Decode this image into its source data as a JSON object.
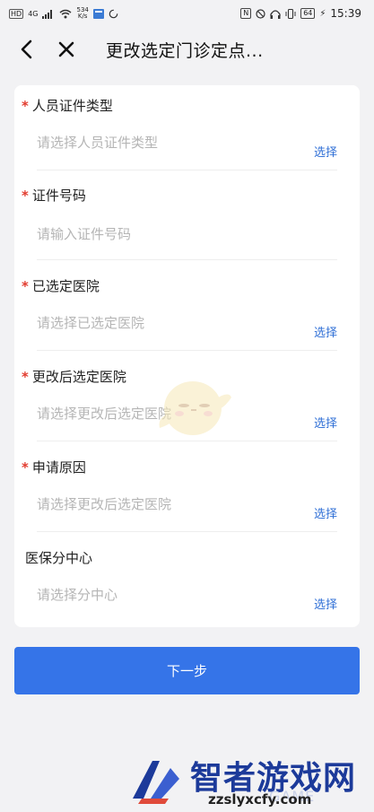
{
  "status_bar": {
    "hd": "HD",
    "net": "4G",
    "speed_value": "534",
    "speed_unit": "K/s",
    "battery": "64",
    "time": "15:39"
  },
  "nav": {
    "title": "更改选定门诊定点..."
  },
  "form": {
    "fields": [
      {
        "label": "人员证件类型",
        "required": "*",
        "placeholder": "请选择人员证件类型",
        "action": "选择"
      },
      {
        "label": "证件号码",
        "required": "*",
        "placeholder": "请输入证件号码",
        "action": ""
      },
      {
        "label": "已选定医院",
        "required": "*",
        "placeholder": "请选择已选定医院",
        "action": "选择"
      },
      {
        "label": "更改后选定医院",
        "required": "*",
        "placeholder": "请选择更改后选定医院",
        "action": "选择"
      },
      {
        "label": "申请原因",
        "required": "*",
        "placeholder": "请选择更改后选定医院",
        "action": "选择"
      },
      {
        "label": "医保分中心",
        "required": "",
        "placeholder": "请选择分中心",
        "action": "选择"
      }
    ]
  },
  "next_button": {
    "label": "下一步"
  },
  "watermark": {
    "brand": "智者游戏网",
    "url": "zzslyxcfy.com",
    "game": "GAME"
  },
  "colors": {
    "accent": "#3574e8",
    "link": "#2f6fd6",
    "required": "#e23b2e",
    "background": "#f2f2f4"
  }
}
